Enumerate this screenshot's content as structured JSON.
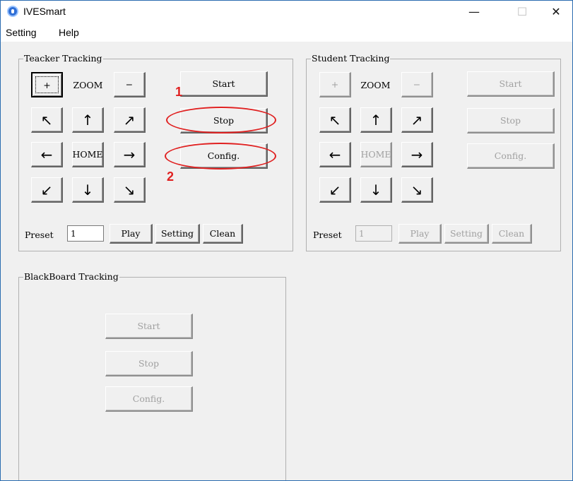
{
  "window": {
    "title": "IVESmart",
    "minimize": "—",
    "maximize": "☐",
    "close": "✕"
  },
  "menu": [
    "Setting",
    "Help"
  ],
  "teacher": {
    "title": "Teacker Tracking",
    "zoom_in": "+",
    "zoom_label": "ZOOM",
    "zoom_out": "−",
    "home": "HOME",
    "arrows": {
      "ul": "↖",
      "up": "↑",
      "ur": "↗",
      "left": "←",
      "right": "→",
      "dl": "↙",
      "down": "↓",
      "dr": "↘"
    },
    "start": "Start",
    "stop": "Stop",
    "config": "Config.",
    "preset_label": "Preset",
    "preset_value": "1",
    "play": "Play",
    "setting": "Setting",
    "clean": "Clean"
  },
  "student": {
    "title": "Student Tracking",
    "zoom_in": "+",
    "zoom_label": "ZOOM",
    "zoom_out": "−",
    "home": "HOME",
    "arrows": {
      "ul": "↖",
      "up": "↑",
      "ur": "↗",
      "left": "←",
      "right": "→",
      "dl": "↙",
      "down": "↓",
      "dr": "↘"
    },
    "start": "Start",
    "stop": "Stop",
    "config": "Config.",
    "preset_label": "Preset",
    "preset_value": "1",
    "play": "Play",
    "setting": "Setting",
    "clean": "Clean"
  },
  "blackboard": {
    "title": "BlackBoard Tracking",
    "start": "Start",
    "stop": "Stop",
    "config": "Config."
  },
  "annotations": {
    "marker_1": "1",
    "marker_2": "2",
    "color": "#e02020"
  }
}
